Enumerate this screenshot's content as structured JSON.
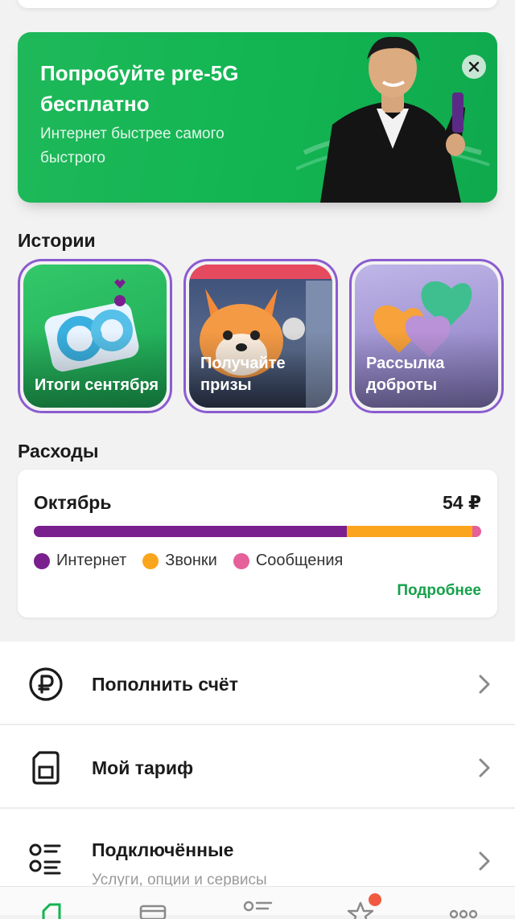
{
  "promo": {
    "title": "Попробуйте pre-5G бесплатно",
    "subtitle": "Интернет быстрее самого быстрого"
  },
  "stories": {
    "title": "Истории",
    "items": [
      {
        "label": "Итоги сентября"
      },
      {
        "label": "Получайте призы"
      },
      {
        "label": "Рассылка доброты"
      }
    ]
  },
  "expenses": {
    "title": "Расходы",
    "month": "Октябрь",
    "amount": "54 ₽",
    "breakdown": [
      {
        "name": "Интернет",
        "share": 0.7,
        "color": "#7a1f8e"
      },
      {
        "name": "Звонки",
        "share": 0.28,
        "color": "#fba51c"
      },
      {
        "name": "Сообщения",
        "share": 0.02,
        "color": "#e6609a"
      }
    ],
    "more_label": "Подробнее"
  },
  "menu": {
    "items": [
      {
        "label": "Пополнить счёт",
        "icon": "ruble-icon"
      },
      {
        "label": "Мой тариф",
        "icon": "sim-card-icon"
      },
      {
        "label": "Подключённые",
        "sublabel": "Услуги, опции и сервисы",
        "icon": "list-icon"
      }
    ]
  },
  "colors": {
    "brand_green": "#12b552",
    "accent_purple": "#8b5cd0",
    "link_green": "#15a14a"
  }
}
